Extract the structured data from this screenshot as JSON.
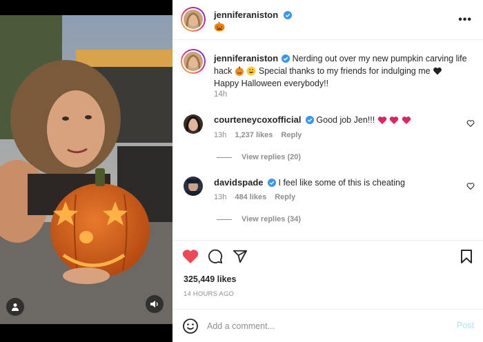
{
  "header": {
    "username": "jenniferaniston",
    "subtitle_emoji": "🎃",
    "more_label": "•••"
  },
  "caption": {
    "username": "jenniferaniston",
    "text_1": "Nerding out over my new pumpkin carving life hack",
    "text_2": "Special thanks to my friends for indulging me",
    "text_3": "Happy Halloween everybody!!",
    "time": "14h"
  },
  "comments": [
    {
      "username": "courteneycoxofficial",
      "text": "Good job Jen!!!",
      "time": "13h",
      "likes": "1,237 likes",
      "reply": "Reply",
      "view_replies": "View replies (20)"
    },
    {
      "username": "davidspade",
      "text": "I feel like some of this is cheating",
      "time": "13h",
      "likes": "484 likes",
      "reply": "Reply",
      "view_replies": "View replies (34)"
    }
  ],
  "likes_count": "325,449 likes",
  "posted_ago": "14 HOURS AGO",
  "add_comment": {
    "placeholder": "Add a comment...",
    "post_label": "Post"
  },
  "colors": {
    "liked_heart": "#ed4956",
    "verified": "#3897f0",
    "post_disabled": "#b2dffc"
  }
}
